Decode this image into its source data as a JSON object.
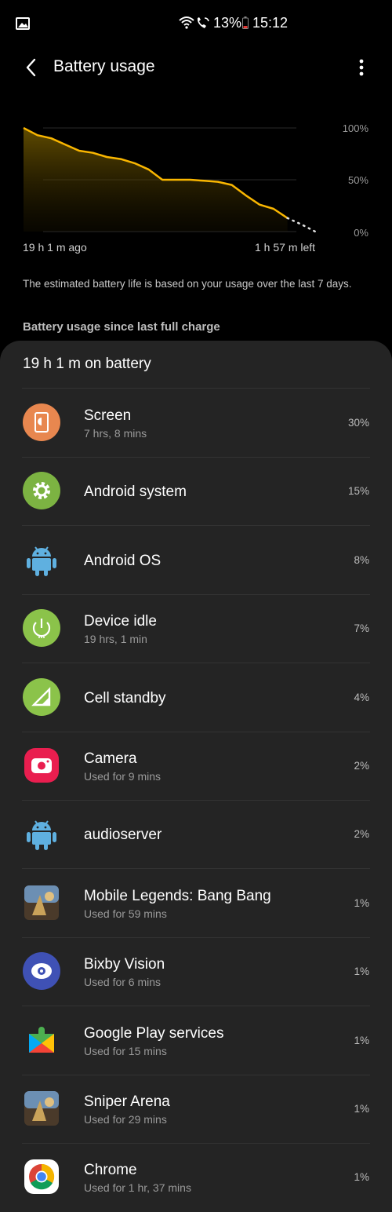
{
  "status_bar": {
    "battery_percent": "13%",
    "time": "15:12"
  },
  "app_bar": {
    "title": "Battery usage"
  },
  "chart_data": {
    "type": "line",
    "title": "",
    "xlabel": "",
    "ylabel": "",
    "x_start_label": "19 h 1 m ago",
    "x_end_label": "1 h 57 m left",
    "y_ticks": [
      "100%",
      "50%",
      "0%"
    ],
    "ylim": [
      0,
      100
    ],
    "series": [
      {
        "x": [
          0,
          1,
          2,
          3,
          4,
          5,
          6,
          7,
          8,
          9,
          10,
          11,
          12,
          13,
          14,
          15,
          16,
          17,
          18,
          19
        ],
        "y": [
          100,
          93,
          90,
          84,
          78,
          76,
          72,
          70,
          66,
          60,
          50,
          50,
          50,
          49,
          48,
          45,
          35,
          26,
          22,
          13
        ]
      }
    ],
    "projection": {
      "x": [
        19,
        20,
        21
      ],
      "y": [
        13,
        7,
        0
      ]
    },
    "grid": true
  },
  "note": "The estimated battery life is based on your usage over the last 7 days.",
  "section_title": "Battery usage since last full charge",
  "sheet_header": "19 h 1 m on battery",
  "items": [
    {
      "name": "Screen",
      "sub": "7 hrs, 8 mins",
      "percent": "30%",
      "icon": "screen-icon"
    },
    {
      "name": "Android system",
      "sub": "",
      "percent": "15%",
      "icon": "gear-icon"
    },
    {
      "name": "Android OS",
      "sub": "",
      "percent": "8%",
      "icon": "android-icon"
    },
    {
      "name": "Device idle",
      "sub": "19 hrs, 1 min",
      "percent": "7%",
      "icon": "power-icon"
    },
    {
      "name": "Cell standby",
      "sub": "",
      "percent": "4%",
      "icon": "signal-icon"
    },
    {
      "name": "Camera",
      "sub": "Used for 9 mins",
      "percent": "2%",
      "icon": "camera-icon"
    },
    {
      "name": "audioserver",
      "sub": "",
      "percent": "2%",
      "icon": "android-icon"
    },
    {
      "name": "Mobile Legends: Bang Bang",
      "sub": "Used for 59 mins",
      "percent": "1%",
      "icon": "game-icon"
    },
    {
      "name": "Bixby Vision",
      "sub": "Used for 6 mins",
      "percent": "1%",
      "icon": "eye-icon"
    },
    {
      "name": "Google Play services",
      "sub": "Used for 15 mins",
      "percent": "1%",
      "icon": "puzzle-icon"
    },
    {
      "name": "Sniper Arena",
      "sub": "Used for 29 mins",
      "percent": "1%",
      "icon": "game-icon"
    },
    {
      "name": "Chrome",
      "sub": "Used for 1 hr, 37 mins",
      "percent": "1%",
      "icon": "chrome-icon"
    }
  ]
}
